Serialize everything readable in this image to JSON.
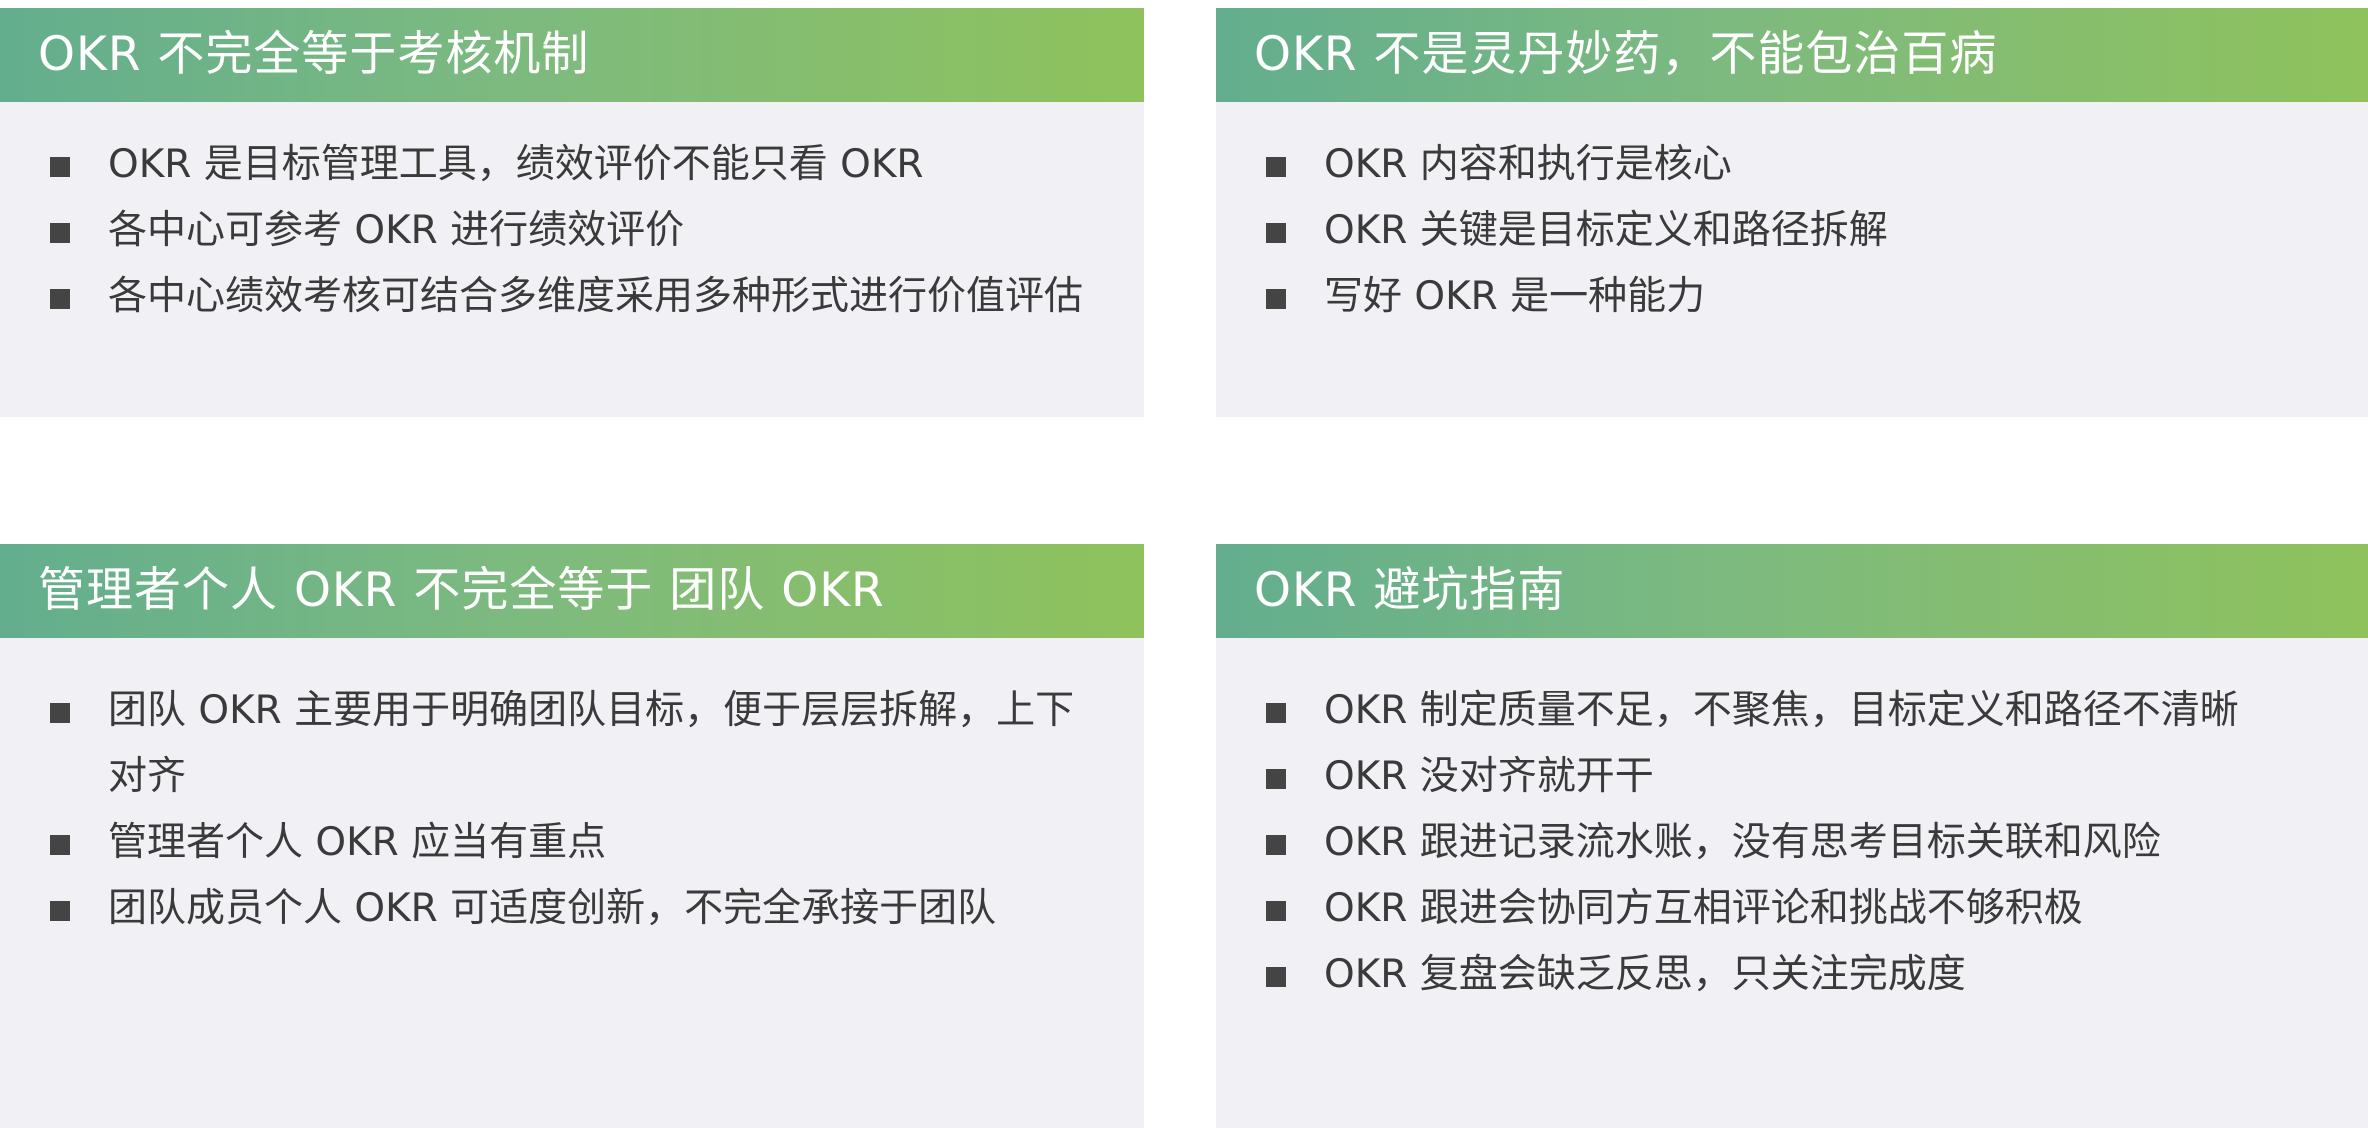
{
  "cards": [
    {
      "title": "OKR 不完全等于考核机制",
      "items": [
        "OKR 是目标管理工具，绩效评价不能只看 OKR",
        "各中心可参考 OKR 进行绩效评价",
        "各中心绩效考核可结合多维度采用多种形式进行价值评估"
      ]
    },
    {
      "title": "OKR 不是灵丹妙药，不能包治百病",
      "items": [
        "OKR 内容和执行是核心",
        "OKR 关键是目标定义和路径拆解",
        "写好 OKR 是一种能力"
      ]
    },
    {
      "title": "管理者个人 OKR 不完全等于 团队 OKR",
      "items": [
        "团队 OKR 主要用于明确团队目标，便于层层拆解，上下对齐",
        "管理者个人 OKR 应当有重点",
        "团队成员个人 OKR 可适度创新，不完全承接于团队"
      ]
    },
    {
      "title": "OKR 避坑指南",
      "items": [
        "OKR 制定质量不足，不聚焦，目标定义和路径不清晰",
        "OKR 没对齐就开干",
        "OKR 跟进记录流水账，没有思考目标关联和风险",
        "OKR 跟进会协同方互相评论和挑战不够积极",
        "OKR 复盘会缺乏反思，只关注完成度"
      ]
    }
  ],
  "colors": {
    "header_gradient_start": "#63ae8e",
    "header_gradient_end": "#8fc25c",
    "body_background": "#f1f1f5",
    "text": "#3a3a3a",
    "bullet": "#444444"
  },
  "icons": {
    "bullet": "square-bullet-icon"
  }
}
